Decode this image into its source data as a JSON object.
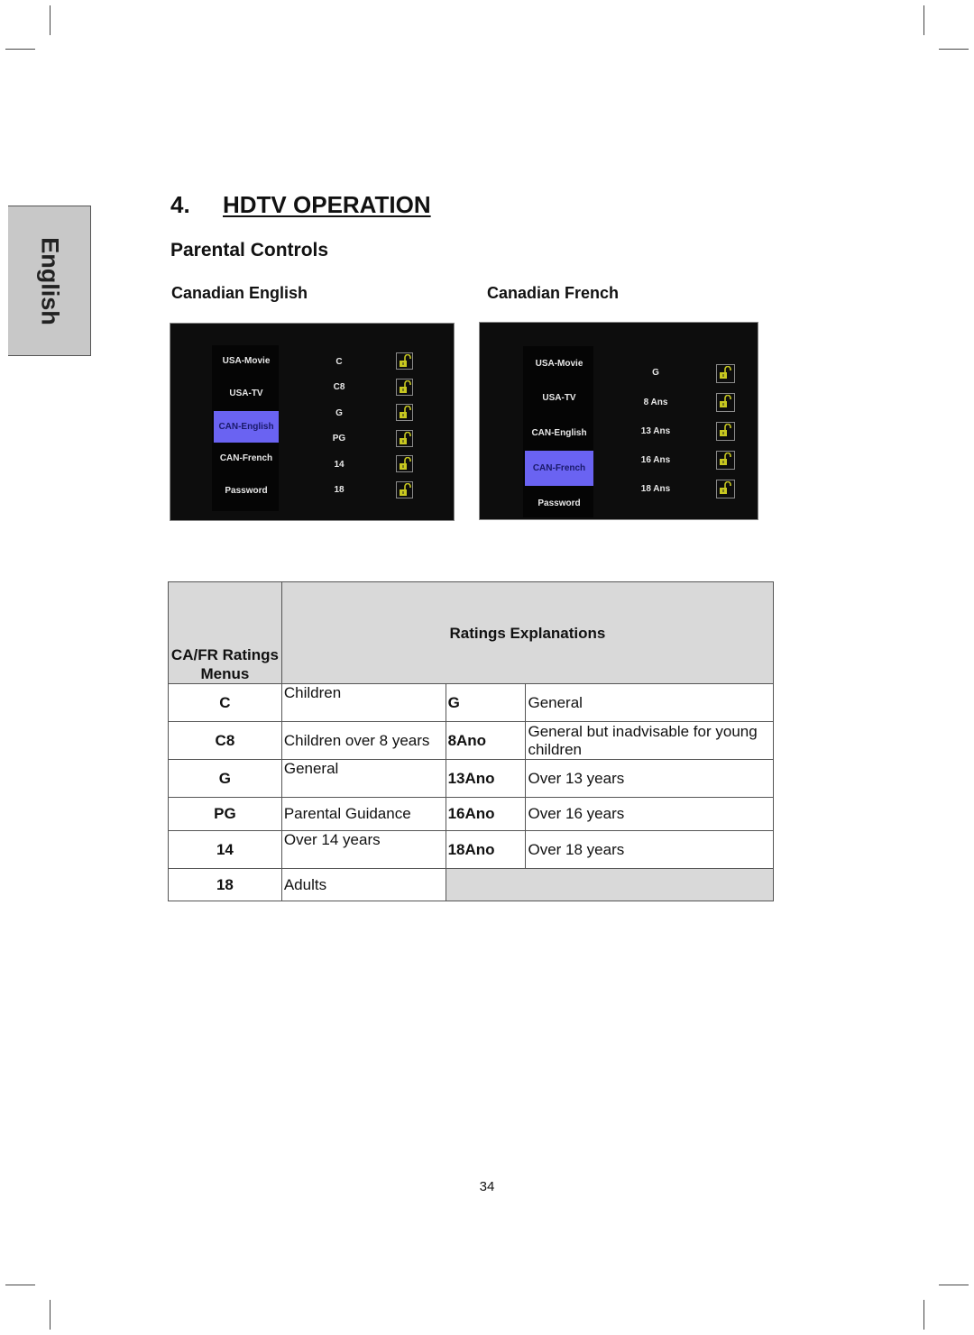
{
  "side_tab": {
    "label": "English"
  },
  "section": {
    "number": "4.",
    "title": "HDTV OPERATION"
  },
  "subtitle": "Parental Controls",
  "panels": [
    {
      "heading": "Canadian English",
      "menu_items": [
        "USA-Movie",
        "USA-TV",
        "CAN-English",
        "CAN-French",
        "Password"
      ],
      "selected": "CAN-English",
      "ratings": [
        "C",
        "C8",
        "G",
        "PG",
        "14",
        "18"
      ],
      "lock_state": "unlocked",
      "lock_icon": "unlocked-padlock-icon"
    },
    {
      "heading": "Canadian French",
      "menu_items": [
        "USA-Movie",
        "USA-TV",
        "CAN-English",
        "CAN-French",
        "Password"
      ],
      "selected": "CAN-French",
      "ratings": [
        "G",
        "8 Ans",
        "13 Ans",
        "16 Ans",
        "18 Ans"
      ],
      "lock_state": "unlocked",
      "lock_icon": "unlocked-padlock-icon"
    }
  ],
  "colors": {
    "selected_menu": "#6a63f2",
    "lock": "#c8c820",
    "header_gray": "#d9d9d9"
  },
  "table": {
    "header_col1": "CA/FR Ratings Menus",
    "header_col2": "Ratings Explanations",
    "rows": [
      {
        "en_code": "C",
        "en_desc": "Children",
        "fr_code": "G",
        "fr_desc": "General"
      },
      {
        "en_code": "C8",
        "en_desc": "Children over 8 years",
        "fr_code": "8Ano",
        "fr_desc": "General but inadvisable for young children"
      },
      {
        "en_code": "G",
        "en_desc": "General",
        "fr_code": "13Ano",
        "fr_desc": "Over 13 years"
      },
      {
        "en_code": "PG",
        "en_desc": "Parental Guidance",
        "fr_code": "16Ano",
        "fr_desc": "Over 16 years"
      },
      {
        "en_code": "14",
        "en_desc": "Over 14 years",
        "fr_code": "18Ano",
        "fr_desc": "Over 18 years"
      },
      {
        "en_code": "18",
        "en_desc": "Adults",
        "fr_code": "",
        "fr_desc": ""
      }
    ]
  },
  "page_number": "34"
}
